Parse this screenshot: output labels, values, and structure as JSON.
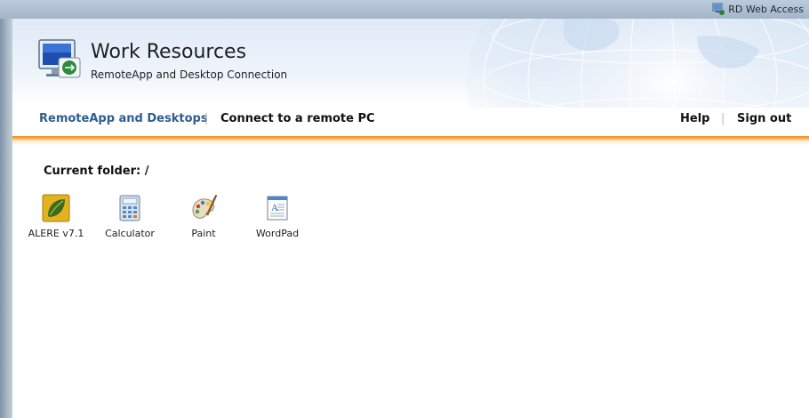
{
  "topbar": {
    "label": "RD Web Access",
    "icon": "rd-web-access-icon"
  },
  "header": {
    "title": "Work Resources",
    "subtitle": "RemoteApp and Desktop Connection",
    "logo_icon": "remote-desktop-monitor-icon"
  },
  "nav": {
    "left": [
      {
        "label": "RemoteApp and Desktops",
        "active": true
      },
      {
        "label": "Connect to a remote PC",
        "active": false
      }
    ],
    "right": [
      {
        "label": "Help"
      },
      {
        "label": "Sign out"
      }
    ],
    "separator": "|"
  },
  "content": {
    "folder_label": "Current folder: /",
    "apps": [
      {
        "label": "ALERE v7.1",
        "icon": "alere-leaf-icon"
      },
      {
        "label": "Calculator",
        "icon": "calculator-icon"
      },
      {
        "label": "Paint",
        "icon": "paint-palette-icon"
      },
      {
        "label": "WordPad",
        "icon": "wordpad-icon"
      }
    ]
  },
  "colors": {
    "accent_active": "#2d5e8e",
    "orange_rule": "#f28c1c",
    "banner": "#dfeaf7"
  }
}
